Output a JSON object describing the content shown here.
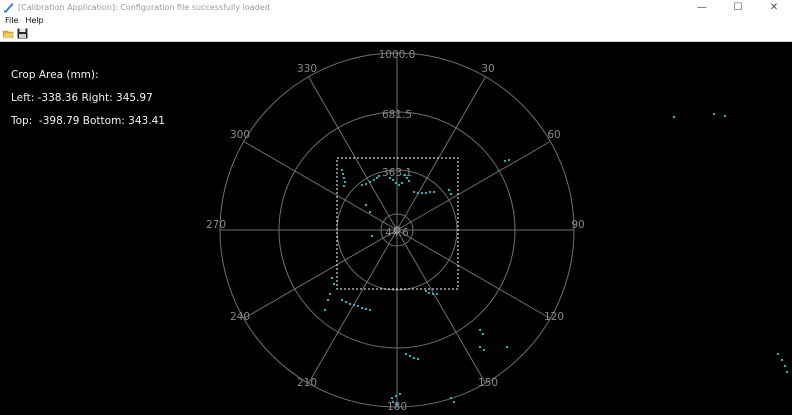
{
  "window": {
    "title": "[Calibration Application]: Configuration file successfully loaded",
    "icon": "calibration-app-icon",
    "controls": {
      "minimize": "—",
      "maximize": "☐",
      "close": "✕"
    }
  },
  "menu": {
    "file": "File",
    "help": "Help"
  },
  "toolbar": {
    "open_icon": "folder-open-icon",
    "save_icon": "save-icon"
  },
  "crop_info": {
    "heading": "Crop Area (mm):",
    "left_right": "Left: -338.36 Right: 345.97",
    "top_bottom": "Top:  -398.79 Bottom: 343.41"
  },
  "polar": {
    "ring_labels": [
      "1000.0",
      "681.5",
      "363.1",
      "44.6"
    ],
    "angle_labels": [
      "330",
      "30",
      "300",
      "60",
      "270",
      "90",
      "240",
      "120",
      "210",
      "150",
      "180"
    ],
    "colors": {
      "points": "#2ec4cf",
      "grid": "#6f6f6f",
      "labels": "#8a8a8a",
      "crop_box": "#ffffff"
    }
  }
}
